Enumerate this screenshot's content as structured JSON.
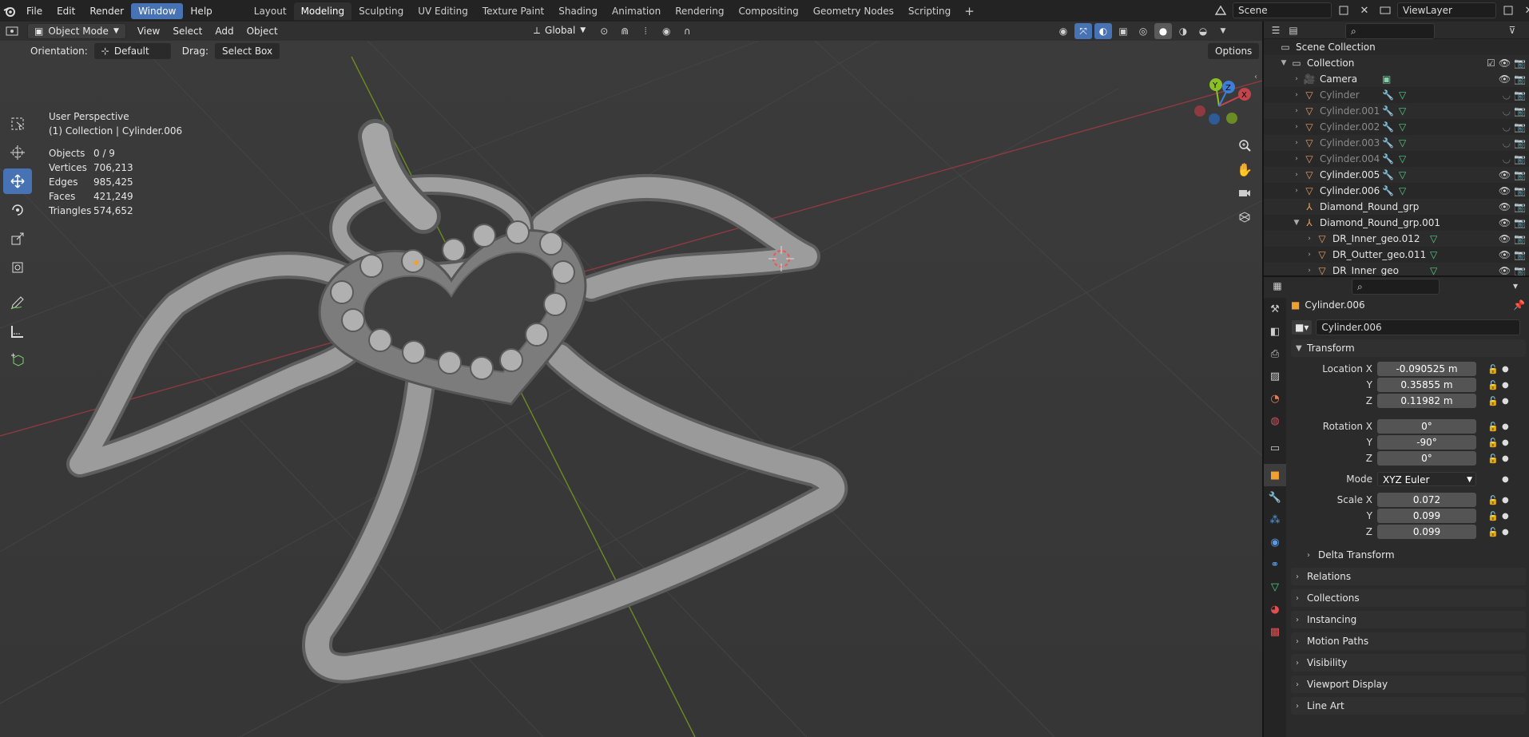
{
  "topbar": {
    "menus": [
      "File",
      "Edit",
      "Render",
      "Window",
      "Help"
    ],
    "active_menu": "Window",
    "workspaces": [
      "Layout",
      "Modeling",
      "Sculpting",
      "UV Editing",
      "Texture Paint",
      "Shading",
      "Animation",
      "Rendering",
      "Compositing",
      "Geometry Nodes",
      "Scripting"
    ],
    "active_workspace": "Modeling",
    "add_symbol": "+",
    "scene": "Scene",
    "view_layer": "ViewLayer"
  },
  "viewport_header": {
    "mode": "Object Mode",
    "menus": [
      "View",
      "Select",
      "Add",
      "Object"
    ],
    "transform_orientation": "Global",
    "orientation_label": "Orientation:",
    "orientation_value": "Default",
    "drag_label": "Drag:",
    "drag_value": "Select Box",
    "options": "Options"
  },
  "overlay": {
    "perspective": "User Perspective",
    "collection": "(1) Collection | Cylinder.006",
    "stats": [
      {
        "k": "Objects",
        "v": "0 / 9"
      },
      {
        "k": "Vertices",
        "v": "706,213"
      },
      {
        "k": "Edges",
        "v": "985,425"
      },
      {
        "k": "Faces",
        "v": "421,249"
      },
      {
        "k": "Triangles",
        "v": "574,652"
      }
    ]
  },
  "gizmo": {
    "x": "X",
    "y": "Y",
    "z": "Z"
  },
  "outliner": {
    "scene_collection": "Scene Collection",
    "collection": "Collection",
    "items": [
      {
        "label": "Camera",
        "icon": "camera-icon",
        "color": "#e8a060",
        "dim": false,
        "visible": true
      },
      {
        "label": "Cylinder",
        "icon": "mesh-icon",
        "color": "#e8a060",
        "dim": true,
        "visible": false
      },
      {
        "label": "Cylinder.001",
        "icon": "mesh-icon",
        "color": "#e8a060",
        "dim": true,
        "visible": false
      },
      {
        "label": "Cylinder.002",
        "icon": "mesh-icon",
        "color": "#e8a060",
        "dim": true,
        "visible": false
      },
      {
        "label": "Cylinder.003",
        "icon": "mesh-icon",
        "color": "#e8a060",
        "dim": true,
        "visible": false
      },
      {
        "label": "Cylinder.004",
        "icon": "mesh-icon",
        "color": "#e8a060",
        "dim": true,
        "visible": false
      },
      {
        "label": "Cylinder.005",
        "icon": "mesh-icon",
        "color": "#e8a060",
        "dim": false,
        "visible": true
      },
      {
        "label": "Cylinder.006",
        "icon": "mesh-icon",
        "color": "#e8a060",
        "dim": false,
        "visible": true
      },
      {
        "label": "Diamond_Round_grp",
        "icon": "empty-icon",
        "color": "#e8a060",
        "dim": false,
        "visible": true
      },
      {
        "label": "Diamond_Round_grp.001",
        "icon": "empty-icon",
        "color": "#e8a060",
        "dim": false,
        "visible": true
      },
      {
        "label": "DR_Inner_geo.012",
        "icon": "mesh-icon",
        "color": "#e8a060",
        "dim": false,
        "visible": true
      },
      {
        "label": "DR_Outter_geo.011",
        "icon": "mesh-icon",
        "color": "#e8a060",
        "dim": false,
        "visible": true
      },
      {
        "label": "DR_Inner_geo",
        "icon": "mesh-icon",
        "color": "#e8a060",
        "dim": false,
        "visible": true
      }
    ]
  },
  "properties": {
    "object_name": "Cylinder.006",
    "data_name": "Cylinder.006",
    "transform": {
      "title": "Transform",
      "location": {
        "label_x": "Location X",
        "x": "-0.090525 m",
        "y": "0.35855 m",
        "z": "0.11982 m"
      },
      "rotation": {
        "label_x": "Rotation X",
        "x": "0°",
        "y": "-90°",
        "z": "0°"
      },
      "mode_label": "Mode",
      "mode": "XYZ Euler",
      "scale": {
        "label_x": "Scale X",
        "x": "0.072",
        "y": "0.099",
        "z": "0.099"
      },
      "axis_y": "Y",
      "axis_z": "Z"
    },
    "delta_transform": "Delta Transform",
    "panels": [
      "Relations",
      "Collections",
      "Instancing",
      "Motion Paths",
      "Visibility",
      "Viewport Display",
      "Line Art"
    ]
  },
  "colors": {
    "accent": "#4772b3",
    "x_axis": "#c4444c",
    "y_axis": "#8cbf26",
    "z_axis": "#3e7fd6"
  }
}
